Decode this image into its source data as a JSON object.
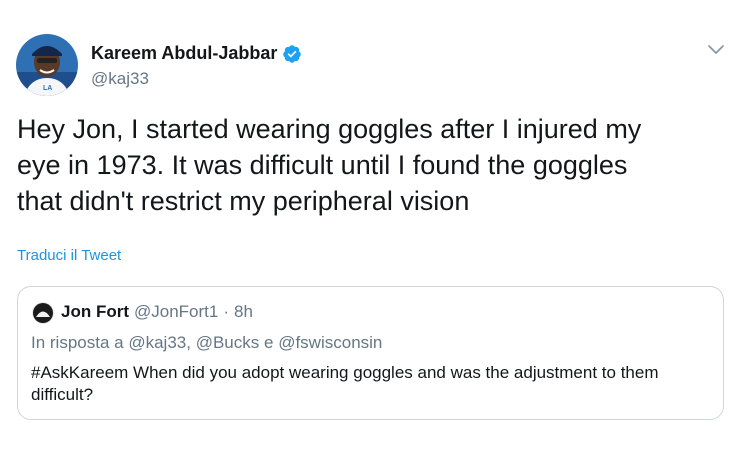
{
  "tweet": {
    "author_name": "Kareem Abdul-Jabbar",
    "author_handle": "@kaj33",
    "text": "Hey Jon, I started wearing goggles after I injured my\neye in 1973.  It was difficult until I found the goggles\nthat didn't restrict my peripheral vision",
    "translate_label": "Traduci il Tweet",
    "verified_icon": "verified-badge-icon",
    "menu_icon": "chevron-down-icon"
  },
  "quote": {
    "author_name": "Jon Fort",
    "author_handle": "@JonFort1",
    "separator": "·",
    "time": "8h",
    "reply_prefix": "In risposta a",
    "reply_mention_1": "@kaj33,",
    "reply_mention_2": "@Bucks",
    "reply_conj": "e",
    "reply_mention_3": "@fswisconsin",
    "text": "#AskKareem When did you adopt wearing goggles and was the adjustment to them difficult?"
  },
  "colors": {
    "text_primary": "#14171a",
    "text_secondary": "#657786",
    "link": "#1b95e0",
    "border": "#ccd6dd",
    "verified": "#1da1f2"
  }
}
